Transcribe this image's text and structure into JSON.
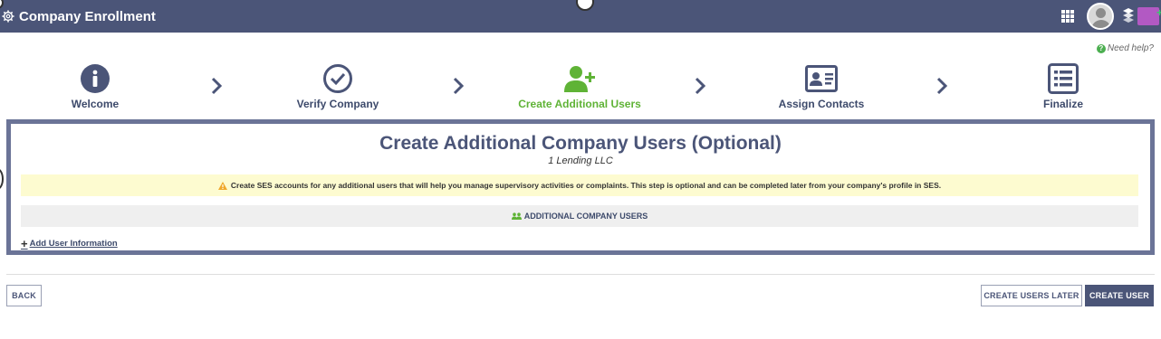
{
  "header": {
    "title": "Company Enrollment",
    "icons": [
      "gear-icon",
      "apps-grid-icon",
      "user-avatar",
      "brand-logo"
    ]
  },
  "help": {
    "label": "Need help?"
  },
  "steps": [
    {
      "label": "Welcome",
      "icon": "info-icon",
      "state": "done"
    },
    {
      "label": "Verify Company",
      "icon": "check-circle-icon",
      "state": "done"
    },
    {
      "label": "Create Additional Users",
      "icon": "add-user-icon",
      "state": "active"
    },
    {
      "label": "Assign Contacts",
      "icon": "contact-card-icon",
      "state": "pending"
    },
    {
      "label": "Finalize",
      "icon": "list-icon",
      "state": "pending"
    }
  ],
  "card": {
    "title": "Create Additional Company Users (Optional)",
    "company": "1 Lending  LLC",
    "warning": "Create SES accounts for any additional users that will help you manage supervisory activities or complaints. This step is optional and can be completed later from your company's profile in SES.",
    "section_header": "ADDITIONAL COMPANY USERS",
    "add_link": "Add User Information"
  },
  "buttons": {
    "back": "BACK",
    "later": "CREATE USERS LATER",
    "create": "CREATE USER"
  },
  "colors": {
    "header_bg": "#4b5578",
    "active_step": "#5fb336",
    "warning_bg": "#fdfbd0",
    "card_border": "#6b7497"
  }
}
